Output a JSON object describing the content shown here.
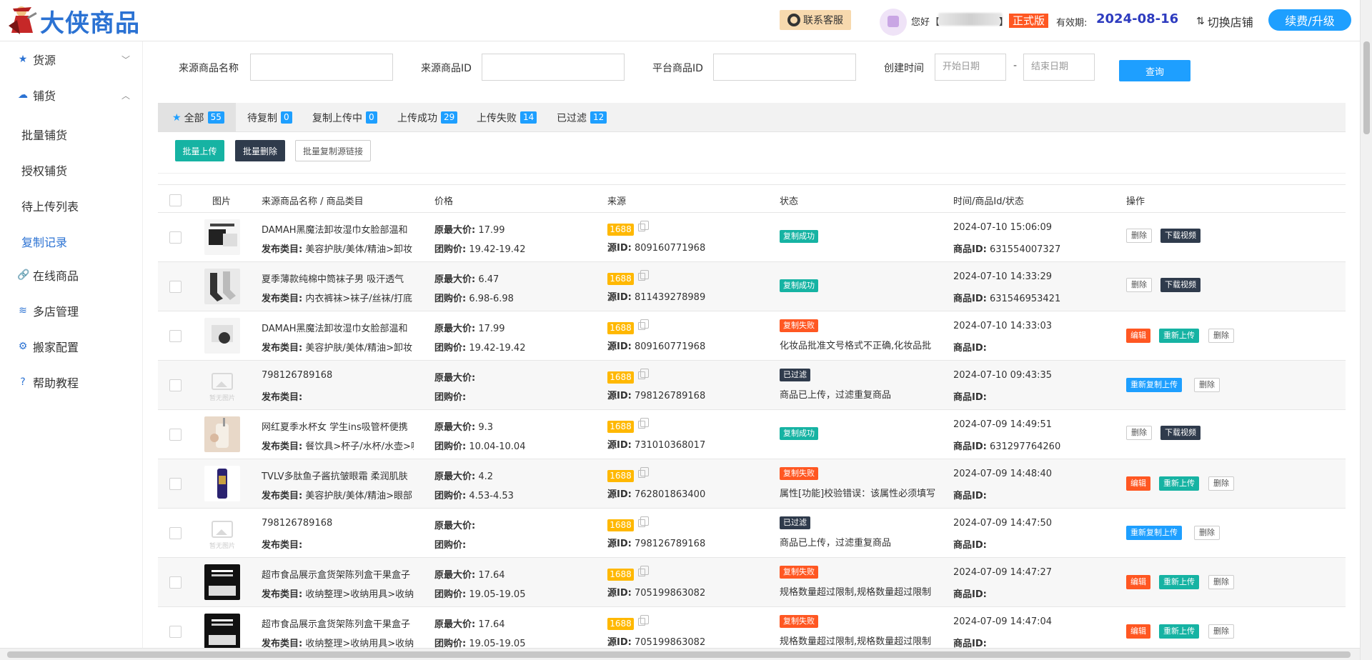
{
  "header": {
    "logo_text": "大侠商品",
    "support_label": "联系客服",
    "greeting": "您好",
    "bracket_open": "【",
    "bracket_close": "】",
    "edition": "正式版",
    "expire_label": "有效期:",
    "expire_date": "2024-08-16",
    "switch_store": "切换店铺",
    "renew": "续费/升级"
  },
  "sidebar": {
    "items": [
      {
        "label": "货源",
        "icon": "star-icon"
      },
      {
        "label": "铺货",
        "icon": "cloud-icon"
      },
      {
        "label": "在线商品",
        "icon": "link-icon"
      },
      {
        "label": "多店管理",
        "icon": "layers-icon"
      },
      {
        "label": "搬家配置",
        "icon": "gear-icon"
      },
      {
        "label": "帮助教程",
        "icon": "help-icon"
      }
    ],
    "sub_items": [
      "批量铺货",
      "授权铺货",
      "待上传列表",
      "复制记录"
    ]
  },
  "search": {
    "source_name_label": "来源商品名称",
    "source_id_label": "来源商品ID",
    "platform_id_label": "平台商品ID",
    "created_label": "创建时间",
    "start_placeholder": "开始日期",
    "end_placeholder": "结束日期",
    "dash": "-",
    "query": "查询"
  },
  "tabs": [
    {
      "label": "全部",
      "count": "55"
    },
    {
      "label": "待复制",
      "count": "0"
    },
    {
      "label": "复制上传中",
      "count": "0"
    },
    {
      "label": "上传成功",
      "count": "29"
    },
    {
      "label": "上传失败",
      "count": "14"
    },
    {
      "label": "已过滤",
      "count": "12"
    }
  ],
  "actions": {
    "bulk_upload": "批量上传",
    "bulk_delete": "批量删除",
    "bulk_copy": "批量复制源链接"
  },
  "table": {
    "headers": [
      "图片",
      "来源商品名称 / 商品类目",
      "价格",
      "来源",
      "状态",
      "时间/商品Id/状态",
      "操作"
    ],
    "labels": {
      "category": "发布类目:",
      "orig_price": "原最大价:",
      "group_price": "团购价:",
      "source_id": "源ID:",
      "product_id": "商品ID:",
      "source_tag": "1688",
      "noimg": "暂无图片"
    },
    "ops": {
      "delete": "删除",
      "video": "下载视频",
      "edit": "编辑",
      "reupload": "重新上传",
      "recopy": "重新复制上传"
    },
    "rows": [
      {
        "title": "DAMAH黑魔法卸妆湿巾女脸部温和",
        "category": "美容护肤/美体/精油>卸妆",
        "orig": "17.99",
        "group": "19.42-19.42",
        "src_id": "809160771968",
        "status": "复制成功",
        "kind": "ok",
        "note": "",
        "time": "2024-07-10 15:06:09",
        "pid": "631554007327",
        "img": "dark"
      },
      {
        "title": "夏季薄款纯棉中筒袜子男 吸汗透气",
        "category": "内衣裤袜>袜子/丝袜/打底",
        "orig": "6.47",
        "group": "6.98-6.98",
        "src_id": "811439278989",
        "status": "复制成功",
        "kind": "ok",
        "note": "",
        "time": "2024-07-10 14:33:29",
        "pid": "631546953421",
        "img": "socks"
      },
      {
        "title": "DAMAH黑魔法卸妆湿巾女脸部温和",
        "category": "美容护肤/美体/精油>卸妆",
        "orig": "17.99",
        "group": "19.42-19.42",
        "src_id": "809160771968",
        "status": "复制失败",
        "kind": "fail",
        "note": "化妆品批准文号格式不正确,化妆品批",
        "time": "2024-07-10 14:33:03",
        "pid": "",
        "img": "light"
      },
      {
        "title": "798126789168",
        "category": "",
        "orig": "",
        "group": "",
        "src_id": "798126789168",
        "status": "已过滤",
        "kind": "filter",
        "note": "商品已上传，过滤重复商品",
        "time": "2024-07-10 09:43:35",
        "pid": "",
        "img": "none"
      },
      {
        "title": "网红夏季水杯女 学生ins吸管杯便携",
        "category": "餐饮具>杯子/水杯/水壶>吸",
        "orig": "9.3",
        "group": "10.04-10.04",
        "src_id": "731010368017",
        "status": "复制成功",
        "kind": "ok",
        "note": "",
        "time": "2024-07-09 14:49:51",
        "pid": "631297764260",
        "img": "cup"
      },
      {
        "title": "TVLV多肽鱼子酱抗皱眼霜 柔润肌肤",
        "category": "美容护肤/美体/精油>眼部",
        "orig": "4.2",
        "group": "4.53-4.53",
        "src_id": "762801863400",
        "status": "复制失败",
        "kind": "fail",
        "note": "属性[功能]校验错误：该属性必须填写",
        "time": "2024-07-09 14:48:40",
        "pid": "",
        "img": "cream"
      },
      {
        "title": "798126789168",
        "category": "",
        "orig": "",
        "group": "",
        "src_id": "798126789168",
        "status": "已过滤",
        "kind": "filter",
        "note": "商品已上传，过滤重复商品",
        "time": "2024-07-09 14:47:50",
        "pid": "",
        "img": "none"
      },
      {
        "title": "超市食品展示盒货架陈列盒干果盒子",
        "category": "收纳整理>收纳用具>收纳",
        "orig": "17.64",
        "group": "19.05-19.05",
        "src_id": "705199863082",
        "status": "复制失败",
        "kind": "fail",
        "note": "规格数量超过限制,规格数量超过限制",
        "time": "2024-07-09 14:47:27",
        "pid": "",
        "img": "box"
      },
      {
        "title": "超市食品展示盒货架陈列盒干果盒子",
        "category": "收纳整理>收纳用具>收纳",
        "orig": "17.64",
        "group": "19.05-19.05",
        "src_id": "705199863082",
        "status": "复制失败",
        "kind": "fail",
        "note": "规格数量超过限制,规格数量超过限制",
        "time": "2024-07-09 14:47:04",
        "pid": "",
        "img": "box"
      }
    ]
  }
}
